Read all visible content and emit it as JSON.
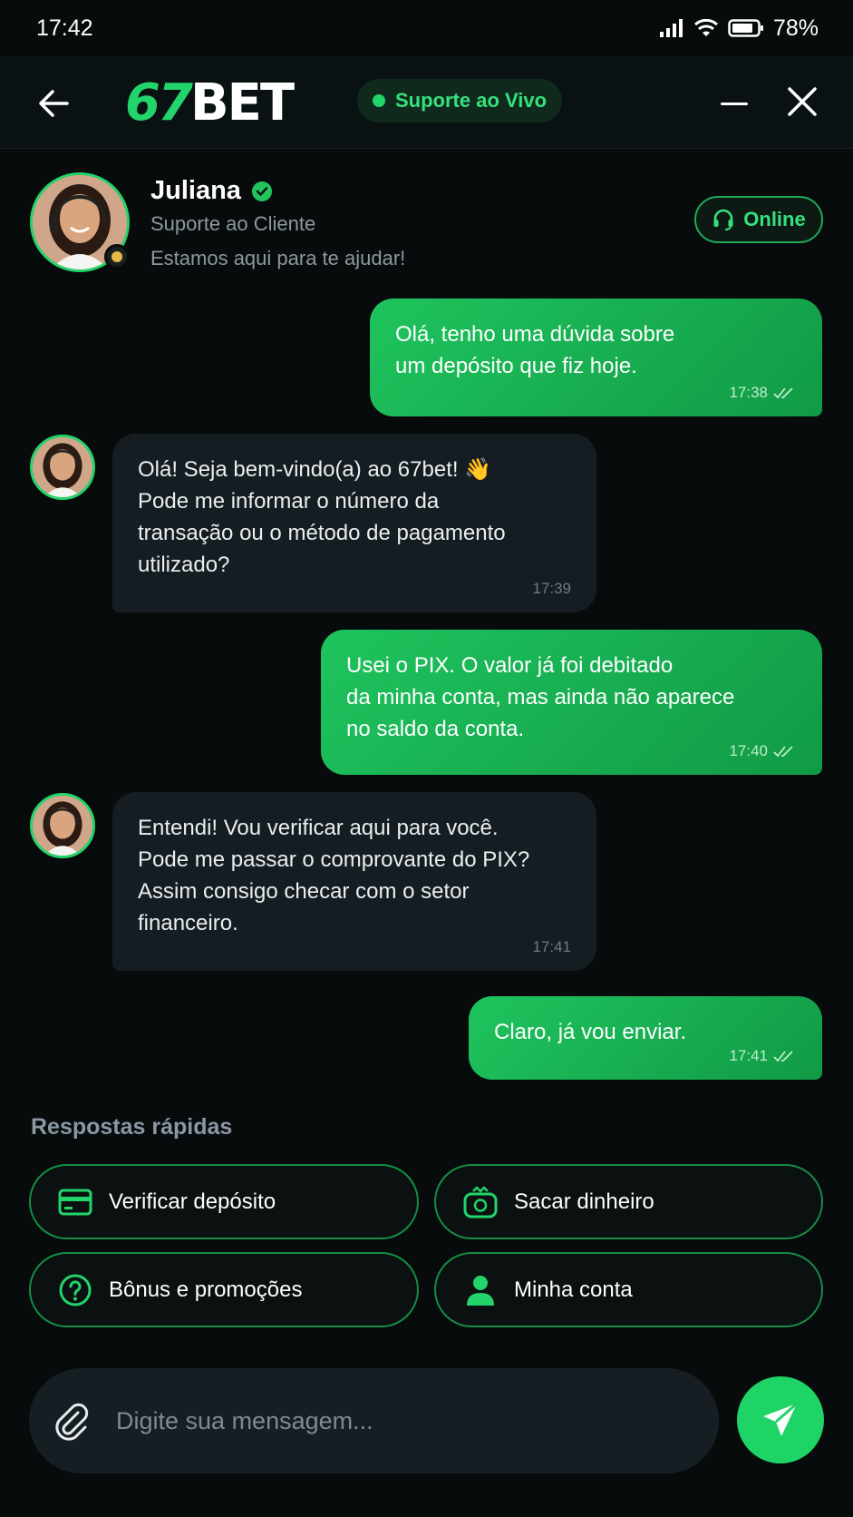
{
  "status_bar": {
    "time": "17:42",
    "battery": "78%"
  },
  "header": {
    "logo_number": "67",
    "logo_text": "BET",
    "live_label": "Suporte ao Vivo"
  },
  "agent": {
    "name": "Juliana",
    "role": "Suporte ao Cliente",
    "tagline": "Estamos aqui para te ajudar!",
    "status_label": "Online"
  },
  "messages": [
    {
      "from": "user",
      "text": "Olá, tenho uma dúvida sobre\num depósito que fiz hoje.",
      "time": "17:38"
    },
    {
      "from": "agent",
      "text": "Olá! Seja bem-vindo(a) ao 67bet! 👋\nPode me informar o número da\ntransação ou o método de pagamento\nutilizado?",
      "time": "17:39"
    },
    {
      "from": "user",
      "text": "Usei o PIX. O valor já foi debitado\nda minha conta, mas ainda não aparece\nno saldo da conta.",
      "time": "17:40"
    },
    {
      "from": "agent",
      "text": "Entendi! Vou verificar aqui para você.\nPode me passar o comprovante do PIX?\nAssim consigo checar com o setor\nfinanceiro.",
      "time": "17:41"
    },
    {
      "from": "user",
      "text": "Claro, já vou enviar.",
      "time": "17:41"
    }
  ],
  "quick_replies": {
    "title": "Respostas rápidas",
    "items": [
      {
        "label": "Verificar depósito",
        "icon": "card-icon"
      },
      {
        "label": "Sacar dinheiro",
        "icon": "cash-icon"
      },
      {
        "label": "Bônus e promoções",
        "icon": "question-icon"
      },
      {
        "label": "Minha conta",
        "icon": "user-icon"
      }
    ]
  },
  "composer": {
    "placeholder": "Digite sua mensagem..."
  },
  "colors": {
    "accent": "#22d46a",
    "background": "#070b0c",
    "bubble_in": "#161d22"
  }
}
